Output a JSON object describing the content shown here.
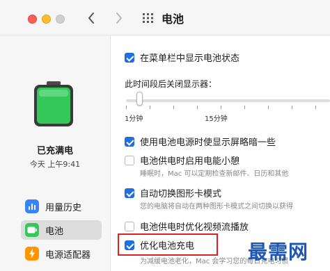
{
  "window": {
    "title": "电池"
  },
  "sidebar": {
    "status_title": "已充满电",
    "status_time": "今天 上午9:41",
    "items": [
      {
        "label": "用量历史",
        "icon": "bar-chart-icon",
        "color": "#3b82f6"
      },
      {
        "label": "电池",
        "icon": "battery-icon",
        "color": "#34c759",
        "active": true
      },
      {
        "label": "电源适配器",
        "icon": "bolt-icon",
        "color": "#ff9500"
      }
    ]
  },
  "settings": {
    "show_status": {
      "label": "在菜单栏中显示电池状态",
      "checked": true
    },
    "display_off": {
      "label": "此时间段后关闭显示器：",
      "value": "1分钟",
      "ticks": [
        "1分钟",
        "15分钟"
      ]
    },
    "dim_display": {
      "label": "使用电池电源时使显示屏略暗一些",
      "checked": true
    },
    "power_nap": {
      "label": "电池供电时启用电能小憩",
      "checked": false,
      "desc": "睡眠时，Mac 可以定期检查新邮件、日历和其他"
    },
    "auto_graphics": {
      "label": "自动切换图形卡模式",
      "checked": true,
      "desc": "您的电脑将自动在两种图形卡模式之间切换以获得"
    },
    "video_streaming": {
      "label": "电池供电时优化视频流播放",
      "checked": false
    },
    "optimized_charging": {
      "label": "优化电池充电",
      "checked": true,
      "desc": "为减缓电池老化，Mac 会学习您的每日充电习惯"
    }
  },
  "watermark": "最需网",
  "colors": {
    "accent": "#1f6fe5",
    "highlight": "#e02020",
    "battery": "#34c759"
  }
}
